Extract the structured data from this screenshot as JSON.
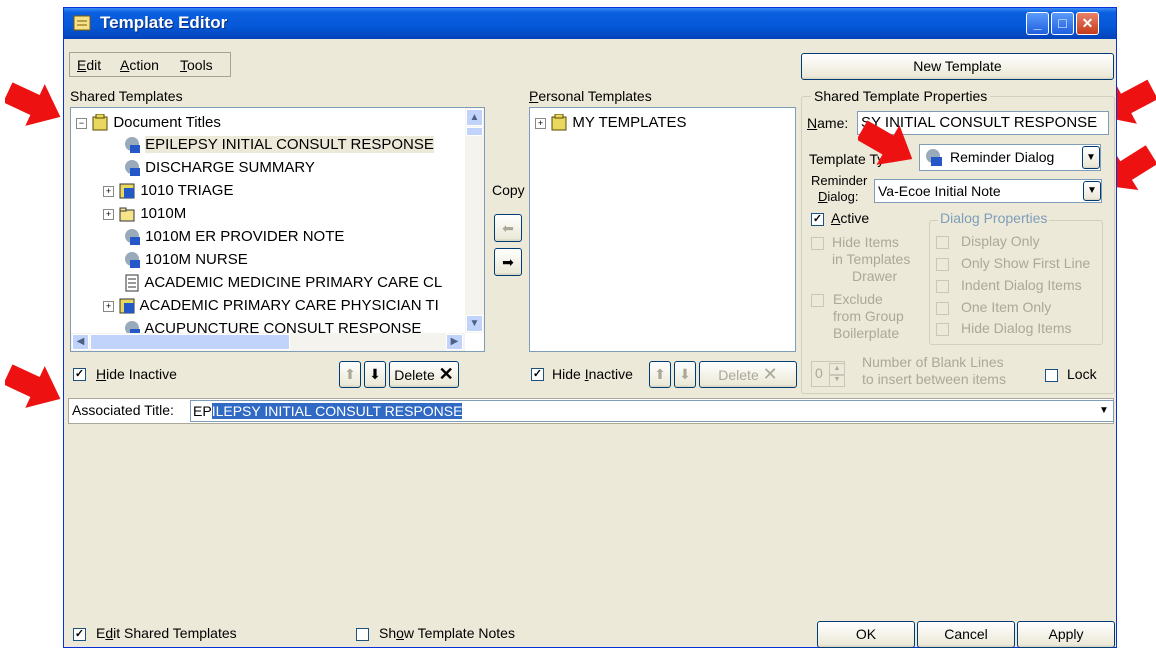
{
  "window": {
    "title": "Template Editor"
  },
  "menu": {
    "edit": "Edit",
    "action": "Action",
    "tools": "Tools"
  },
  "new_template_button": "New Template",
  "shared": {
    "label": "Shared Templates",
    "root": "Document Titles",
    "items": [
      "EPILEPSY INITIAL CONSULT RESPONSE",
      "DISCHARGE SUMMARY",
      "1010 TRIAGE",
      "1010M",
      "1010M ER PROVIDER NOTE",
      "1010M NURSE",
      "ACADEMIC MEDICINE PRIMARY CARE CL",
      "ACADEMIC PRIMARY CARE PHYSICIAN TI",
      "ACUPUNCTURE CONSULT RESPONSE"
    ],
    "hide_inactive": "Hide Inactive",
    "delete": "Delete"
  },
  "copy_label": "Copy",
  "personal": {
    "label": "Personal Templates",
    "root": "MY TEMPLATES",
    "hide_inactive": "Hide Inactive",
    "delete": "Delete"
  },
  "properties": {
    "label": "Shared Template Properties",
    "name_label": "Name:",
    "name_value": "SY INITIAL CONSULT RESPONSE",
    "type_label": "Template Ty",
    "type_value": "Reminder Dialog",
    "reminder_label_1": "Reminder",
    "reminder_label_2": "Dialog:",
    "reminder_value": "Va-Ecoe Initial Note",
    "active": "Active",
    "hide_items_1": "Hide Items",
    "hide_items_2": "in Templates",
    "hide_items_3": "Drawer",
    "exclude_1": "Exclude",
    "exclude_2": "from Group",
    "exclude_3": "Boilerplate",
    "dialog_props": "Dialog Properties",
    "display_only": "Display Only",
    "only_first": "Only Show First Line",
    "indent": "Indent Dialog Items",
    "one_item": "One Item Only",
    "hide_dialog": "Hide Dialog Items",
    "blank_value": "0",
    "blank_label_1": "Number of Blank Lines",
    "blank_label_2": "to insert between items",
    "lock": "Lock"
  },
  "associated": {
    "label": "Associated Title:",
    "value_plain": "EP",
    "value_selected": "ILEPSY INITIAL CONSULT RESPONSE"
  },
  "footer": {
    "edit_shared": "Edit Shared Templates",
    "show_notes": "Show Template Notes",
    "ok": "OK",
    "cancel": "Cancel",
    "apply": "Apply"
  },
  "colors": {
    "titlebar": "#0558d8",
    "selection": "#316ac5",
    "annotation_arrow": "#ee1111",
    "face": "#ece9d8"
  }
}
